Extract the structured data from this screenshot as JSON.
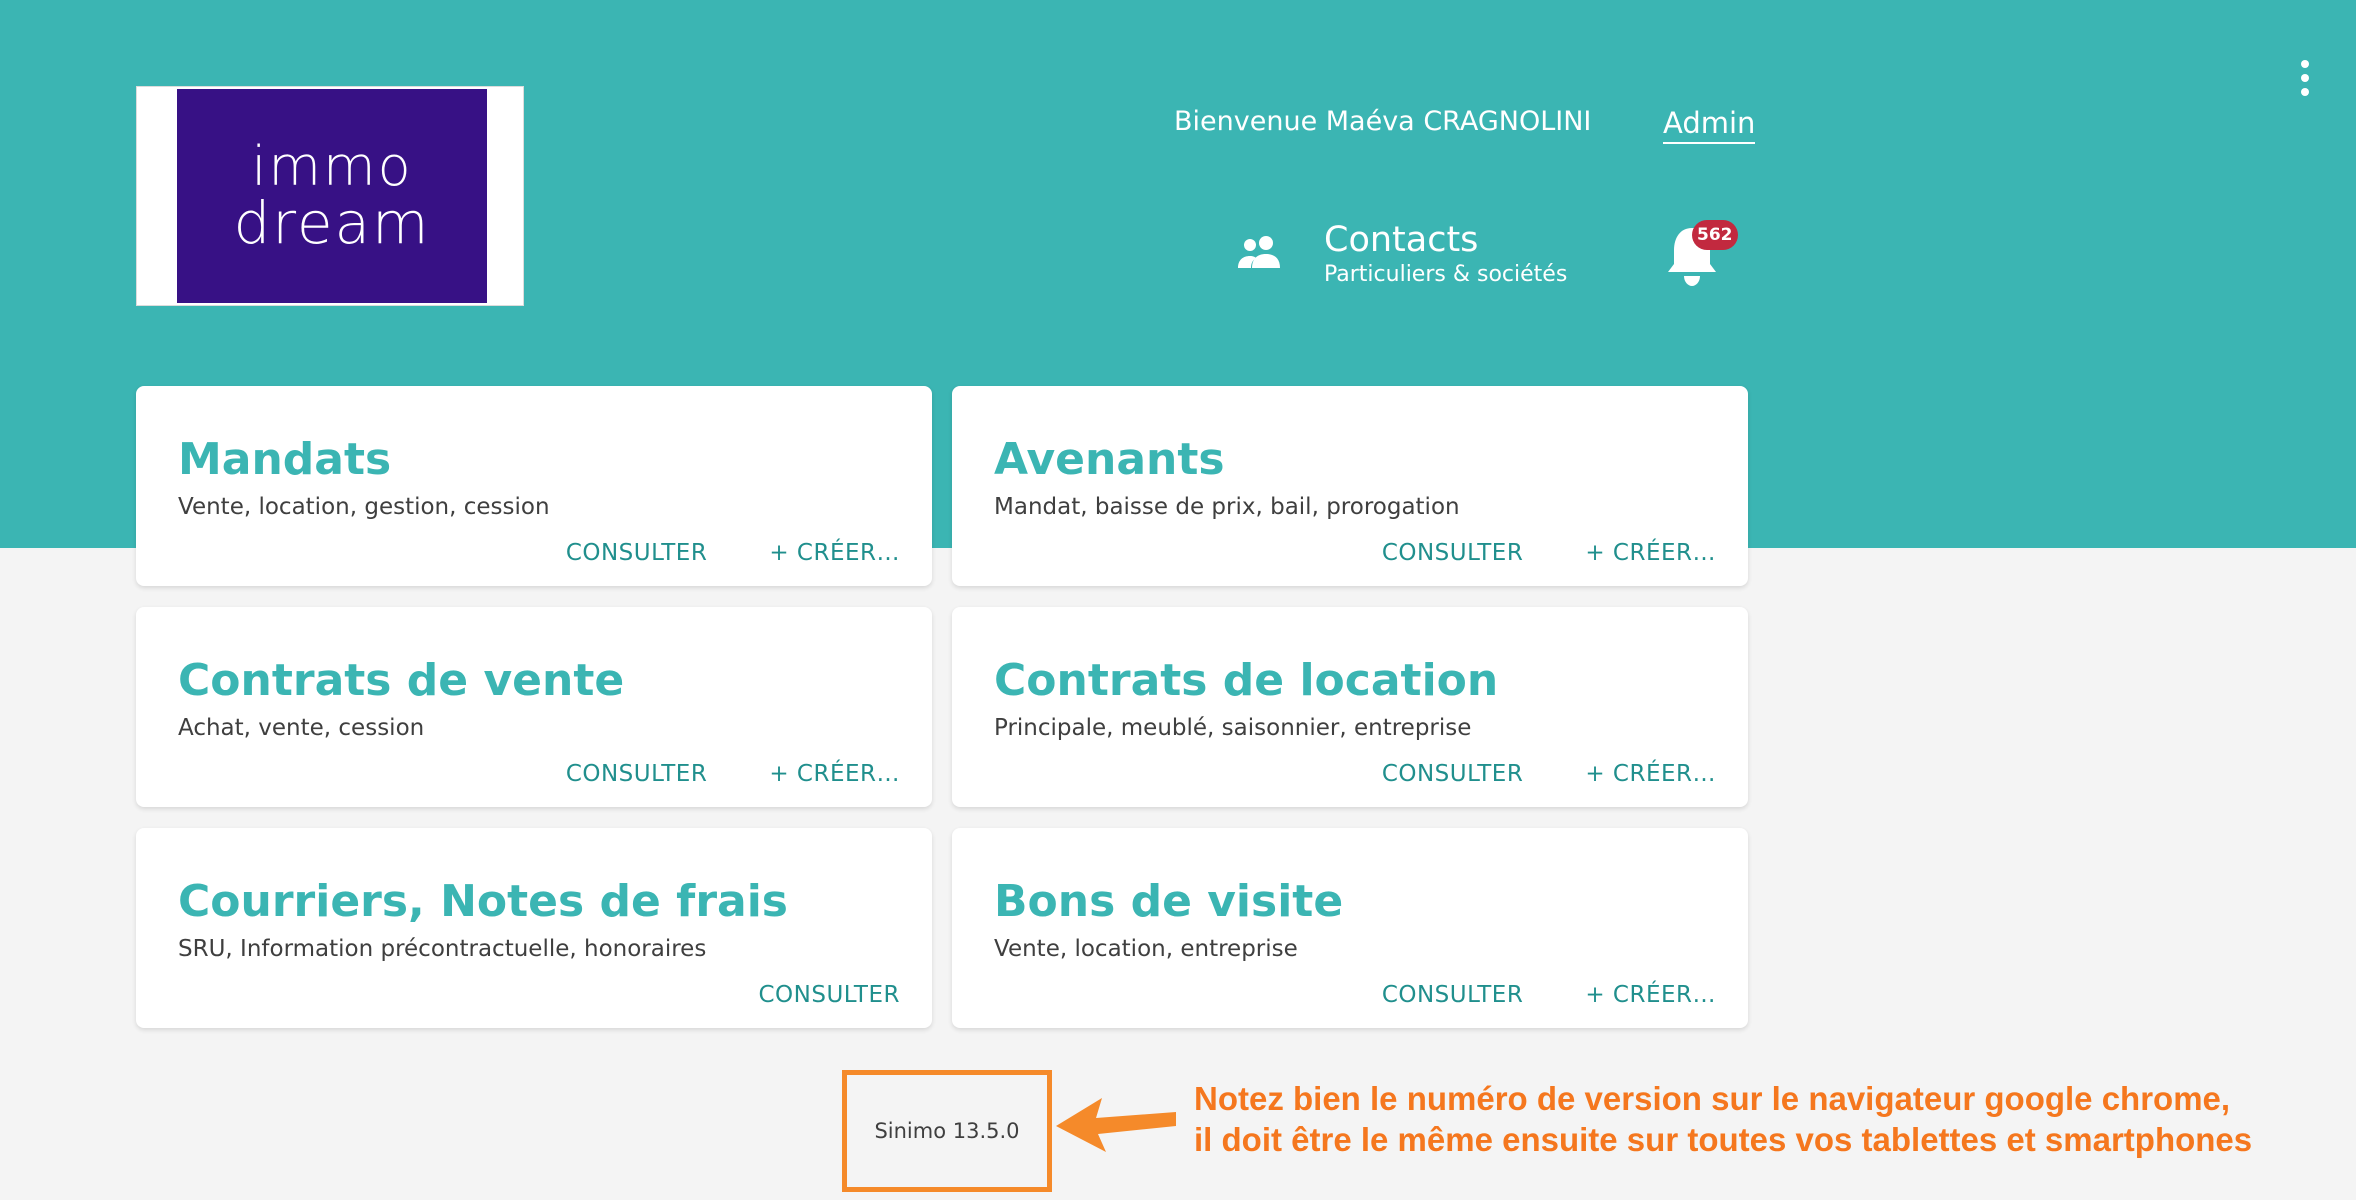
{
  "header": {
    "logo": {
      "line1": "immo",
      "line2": "dream"
    },
    "welcome": "Bienvenue Maéva CRAGNOLINI",
    "admin_label": "Admin",
    "contacts": {
      "title": "Contacts",
      "subtitle": "Particuliers & sociétés",
      "icon": "people-icon"
    },
    "notifications": {
      "count": "562",
      "icon": "bell-icon"
    },
    "menu_icon": "kebab-menu-icon"
  },
  "cards": [
    {
      "title": "Mandats",
      "subtitle": "Vente, location, gestion, cession",
      "consult": "CONSULTER",
      "create": "+ CRÉER…"
    },
    {
      "title": "Avenants",
      "subtitle": "Mandat, baisse de prix, bail, prorogation",
      "consult": "CONSULTER",
      "create": "+ CRÉER…"
    },
    {
      "title": "Contrats de vente",
      "subtitle": "Achat, vente, cession",
      "consult": "CONSULTER",
      "create": "+ CRÉER…"
    },
    {
      "title": "Contrats de location",
      "subtitle": "Principale, meublé, saisonnier, entreprise",
      "consult": "CONSULTER",
      "create": "+ CRÉER…"
    },
    {
      "title": "Courriers, Notes de frais",
      "subtitle": "SRU, Information précontractuelle, honoraires",
      "consult": "CONSULTER"
    },
    {
      "title": "Bons de visite",
      "subtitle": "Vente, location, entreprise",
      "consult": "CONSULTER",
      "create": "+ CRÉER…"
    }
  ],
  "footer": {
    "version": "Sinimo 13.5.0",
    "note_line1": "Notez bien le numéro de version sur le navigateur google chrome,",
    "note_line2": "il doit être le même ensuite sur toutes vos tablettes et smartphones"
  },
  "colors": {
    "teal": "#3bb5b3",
    "teal_dark": "#208f8d",
    "logo_purple": "#371185",
    "badge_red": "#c2293f",
    "annotation_orange": "#f58a2a"
  }
}
